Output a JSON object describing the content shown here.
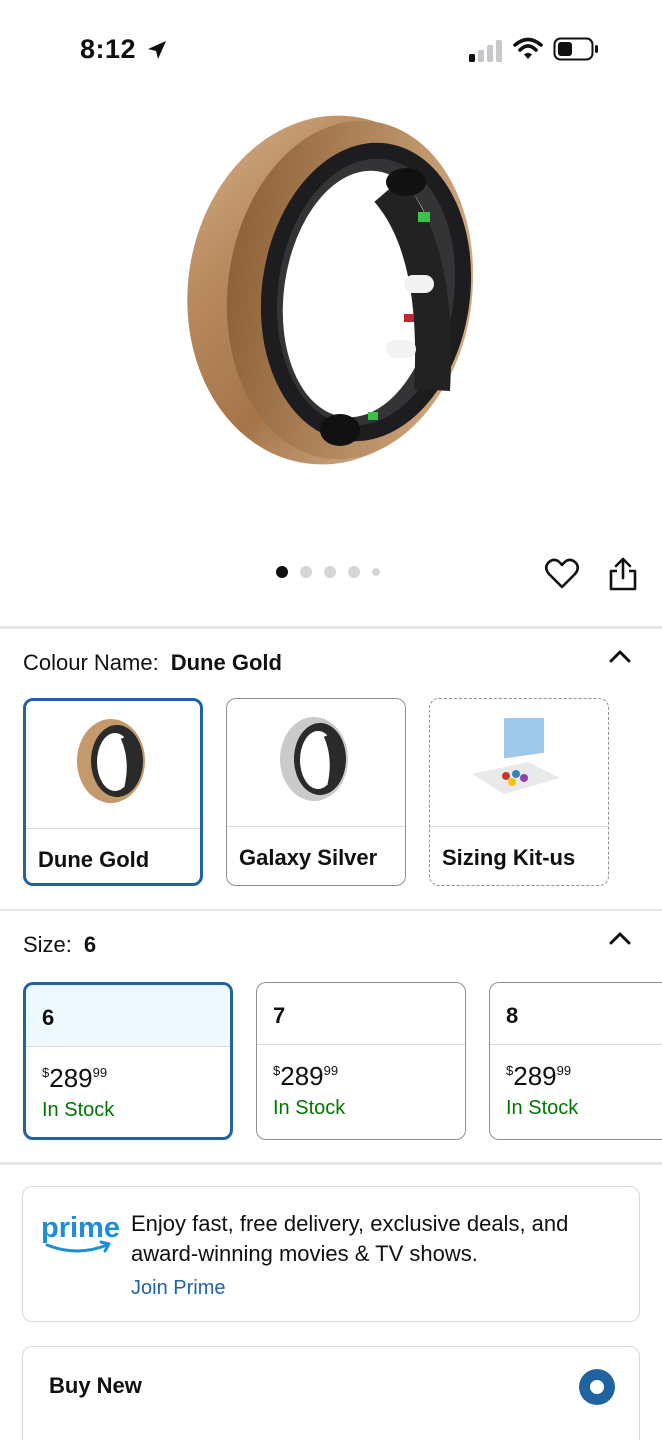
{
  "status_bar": {
    "time": "8:12",
    "icons": [
      "location-arrow-icon",
      "cellular-signal-icon",
      "wifi-icon",
      "battery-icon"
    ]
  },
  "product": {
    "image_alt": "Gold smart ring",
    "carousel_pages": 5,
    "carousel_active": 1
  },
  "colour": {
    "label": "Colour Name:",
    "selected": "Dune Gold",
    "options": [
      {
        "name": "Dune Gold",
        "selected": true
      },
      {
        "name": "Galaxy Silver",
        "selected": false
      },
      {
        "name": "Sizing Kit-us",
        "selected": false
      }
    ]
  },
  "size": {
    "label": "Size:",
    "selected": "6",
    "options": [
      {
        "size": "6",
        "currency": "$",
        "price_main": "289",
        "price_cents": "99",
        "stock": "In Stock"
      },
      {
        "size": "7",
        "currency": "$",
        "price_main": "289",
        "price_cents": "99",
        "stock": "In Stock"
      },
      {
        "size": "8",
        "currency": "$",
        "price_main": "289",
        "price_cents": "99",
        "stock": "In Stock"
      }
    ]
  },
  "prime": {
    "logo_text": "prime",
    "message": "Enjoy fast, free delivery, exclusive deals, and award-winning movies & TV shows.",
    "link": "Join Prime"
  },
  "buy": {
    "title": "Buy New"
  },
  "colors": {
    "accent": "#2162a1",
    "in_stock": "#007600",
    "prime_blue": "#1a8fd8"
  }
}
